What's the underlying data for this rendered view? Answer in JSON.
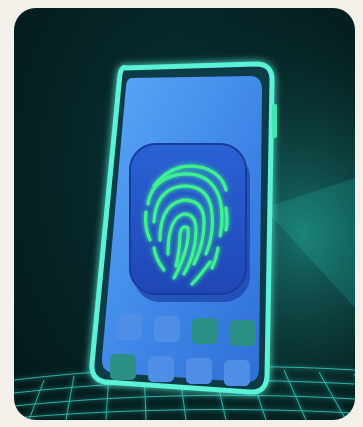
{
  "illustration": {
    "subject": "phone-fingerprint-scan",
    "icon": "fingerprint-icon",
    "colors": {
      "background_dark": "#041818",
      "background_teal": "#0b4b4a",
      "phone_frame_glow": "#5cf2d8",
      "phone_screen": "#3f86e8",
      "phone_screen_light": "#5aa4f4",
      "scanner_pad": "#2456c9",
      "fingerprint": "#3df28f",
      "app_tile_blue": "#4f8ee6",
      "app_tile_teal": "#2b8f86",
      "grid_floor": "#3ce0d0",
      "page_background": "#f3f0ea"
    },
    "app_tiles": [
      {
        "color": "blue"
      },
      {
        "color": "blue"
      },
      {
        "color": "teal"
      },
      {
        "color": "teal"
      },
      {
        "color": "teal"
      },
      {
        "color": "blue"
      },
      {
        "color": "blue"
      },
      {
        "color": "blue"
      }
    ]
  }
}
